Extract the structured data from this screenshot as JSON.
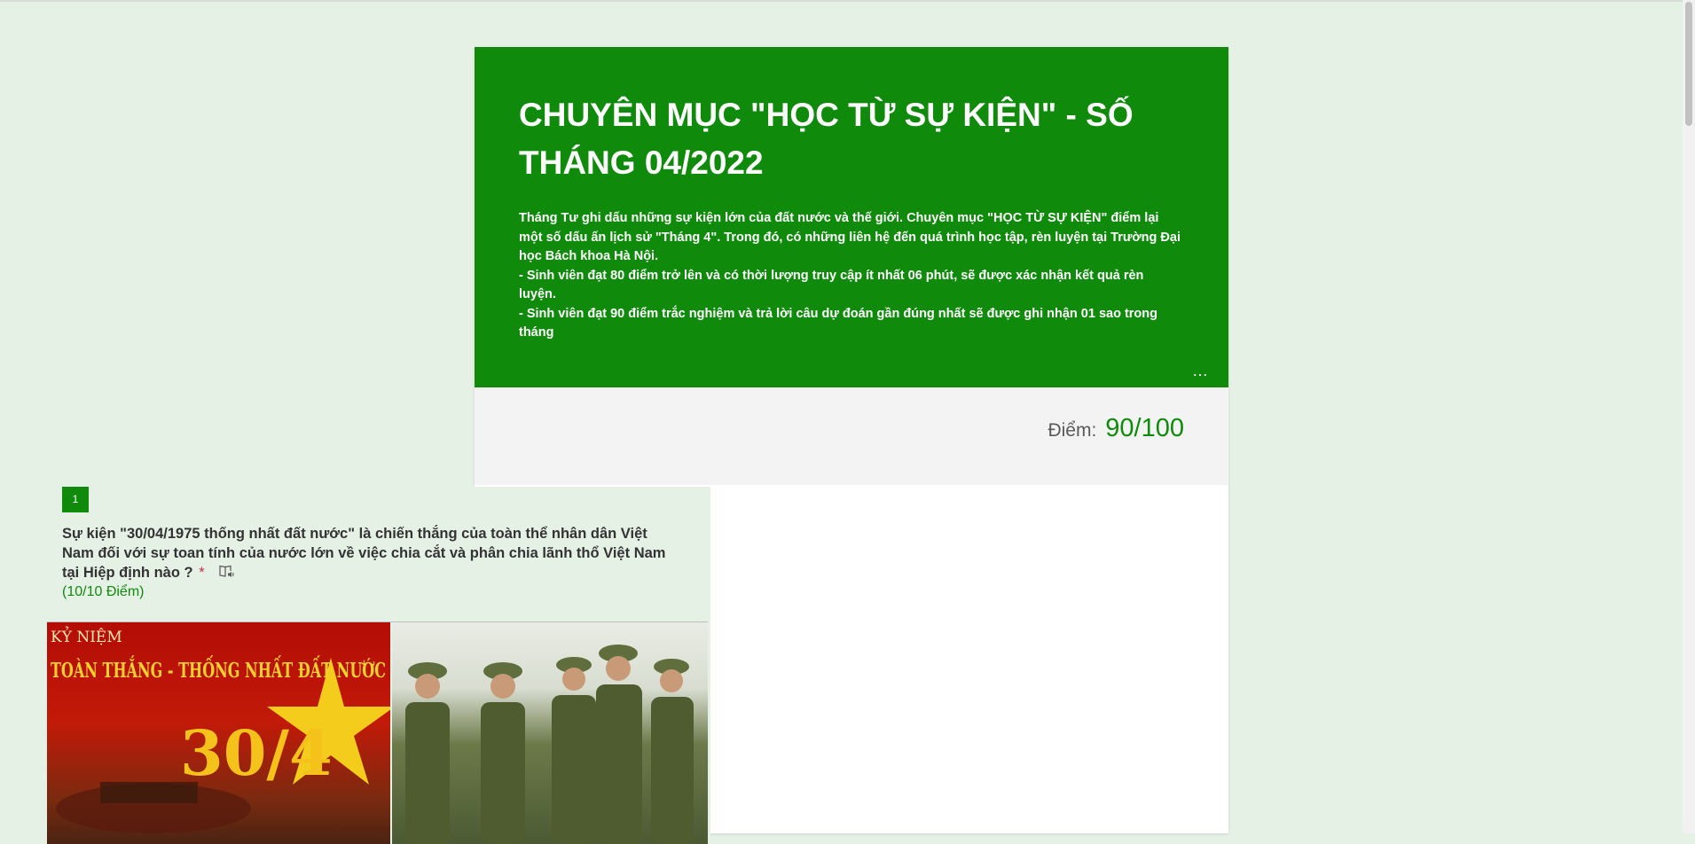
{
  "form": {
    "title": "CHUYÊN MỤC \"HỌC TỪ SỰ KIỆN\" - SỐ THÁNG 04/2022",
    "description": [
      "Tháng Tư ghi dấu những sự kiện lớn của đất nước và thế giới. Chuyên mục \"HỌC TỪ SỰ KIỆN\" điểm lại một số dấu ấn lịch sử \"Tháng 4\". Trong đó, có những liên hệ đến quá trình học tập, rèn luyện tại Trường Đại học Bách khoa Hà Nội.",
      "- Sinh viên đạt 80 điểm trở lên và có thời lượng truy cập ít nhất 06 phút, sẽ được xác nhận kết quả rèn luyện.",
      "- Sinh viên đạt 90 điểm trắc nghiệm và trả lời câu dự đoán gần đúng nhất sẽ được ghi nhận 01 sao trong tháng"
    ],
    "more_icon": "…"
  },
  "score": {
    "label": "Điểm:",
    "value": "90/100"
  },
  "question": {
    "number": "1",
    "text": "Sự kiện \"30/04/1975 thống nhất đất nước\" là chiến thắng của toàn thể nhân dân Việt Nam đối với sự toan tính của nước lớn về việc chia cắt và phân chia lãnh thổ Việt Nam tại Hiệp định nào ?",
    "required_mark": "*",
    "points": "(10/10 Điểm)",
    "image": {
      "banner_line1": "KỶ NIỆM",
      "banner_line2": "TOÀN THẮNG - THỐNG NHẤT ĐẤT NƯỚC",
      "banner_date": "30/4"
    }
  },
  "colors": {
    "brand_green": "#0f8a0b",
    "page_background": "#e6f1e6",
    "required_red": "#c4314b"
  },
  "icons": {
    "reader": "immersive-reader-icon",
    "more": "more-options-icon"
  }
}
